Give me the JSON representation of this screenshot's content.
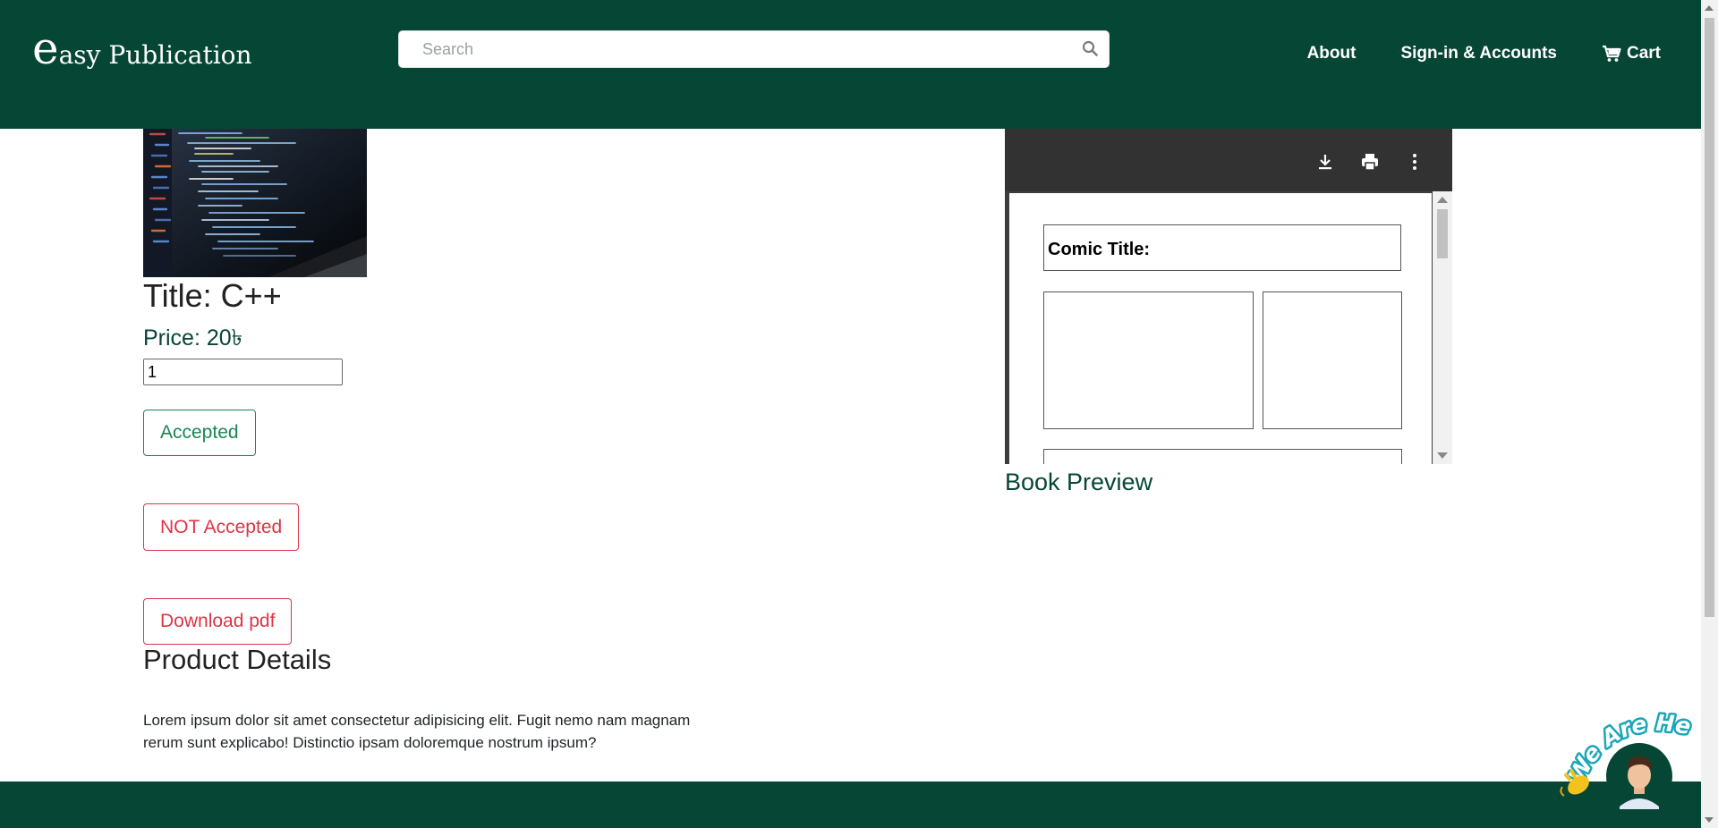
{
  "header": {
    "brand_initial": "e",
    "brand_rest": "asy Publication",
    "search_placeholder": "Search",
    "nav": [
      {
        "label": "About"
      },
      {
        "label": "Sign-in & Accounts"
      },
      {
        "label": "Cart"
      }
    ]
  },
  "product": {
    "title": "Title: C++",
    "price": "Price: 20৳",
    "quantity": "1",
    "accept_label": "Accepted",
    "reject_label": "NOT Accepted",
    "download_label": "Download pdf",
    "details_heading": "Product Details",
    "details_text": "Lorem ipsum dolor sit amet consectetur adipisicing elit. Fugit nemo nam magnam rerum sunt explicabo! Distinctio ipsam doloremque nostrum ipsum?"
  },
  "preview": {
    "comic_title": "Comic Title:",
    "label": "Book Preview"
  },
  "widget": {
    "text": "We Are Here!"
  },
  "colors": {
    "brand_green": "#064635",
    "accept": "#198754",
    "reject": "#dc3545",
    "pdf_toolbar": "#323232",
    "widget_teal": "#1aa6b7"
  },
  "icons": {
    "search": "search-icon",
    "cart": "cart-icon",
    "download": "download-icon",
    "print": "print-icon",
    "more": "more-vertical-icon",
    "wave": "waving-hand-icon",
    "avatar": "avatar"
  }
}
